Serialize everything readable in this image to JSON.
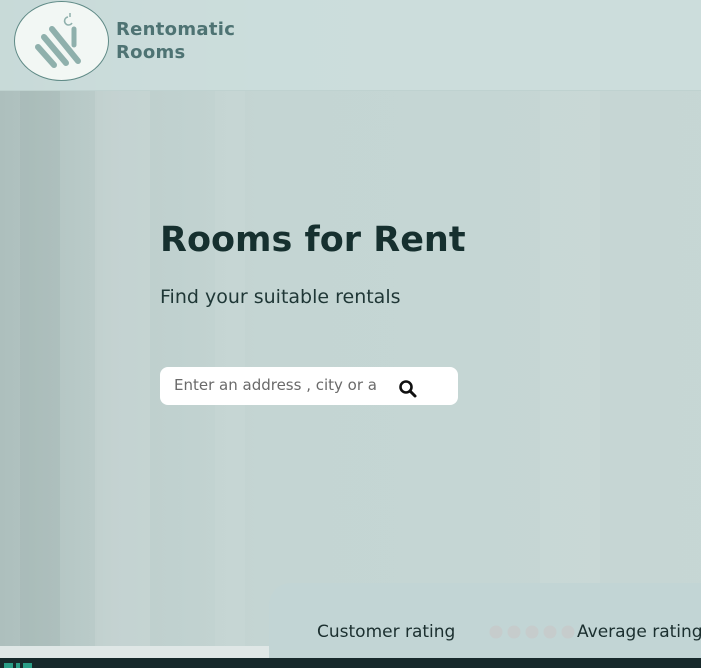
{
  "header": {
    "brand_line1": "Rentomatic",
    "brand_line2": "Rooms",
    "logo_icon": "rentomatic-logo"
  },
  "hero": {
    "title": "Rooms for Rent",
    "subtitle": "Find your suitable rentals"
  },
  "search": {
    "placeholder": "Enter an address , city or a",
    "icon": "search-icon"
  },
  "rating": {
    "label": "Customer rating",
    "stars_total": 5,
    "value_label": "Average rating"
  },
  "colors": {
    "brand_text": "#4e7373",
    "title": "#16302f",
    "star_inactive": "#c9cfcf",
    "footer": "#17292b",
    "accent": "#2a9d86"
  }
}
